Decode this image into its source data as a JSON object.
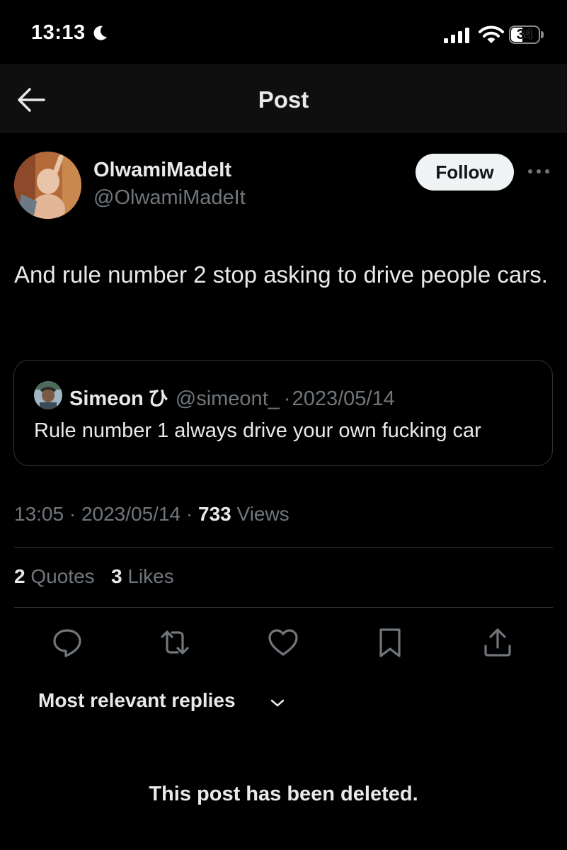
{
  "status_bar": {
    "time": "13:13",
    "battery": "34",
    "icons": [
      "moon-icon",
      "cellular-signal-icon",
      "wifi-icon",
      "battery-icon"
    ]
  },
  "nav": {
    "title": "Post",
    "back_icon": "arrow-left-icon"
  },
  "post": {
    "author": {
      "name": "OlwamiMadeIt",
      "handle": "@OlwamiMadeIt"
    },
    "follow_label": "Follow",
    "more_icon": "ellipsis-icon",
    "text": "And rule number 2 stop asking to drive people cars.",
    "quote": {
      "name": "Simeon",
      "badge": "ひ",
      "handle": "@simeont_",
      "separator": "·",
      "date": "2023/05/14",
      "text": "Rule number 1 always drive your own fucking car"
    },
    "meta": {
      "time": "13:05",
      "date": "2023/05/14",
      "views_count": "733",
      "views_label": "Views"
    },
    "stats": {
      "quotes_count": "2",
      "quotes_label": "Quotes",
      "likes_count": "3",
      "likes_label": "Likes"
    },
    "actions": [
      "reply-icon",
      "repost-icon",
      "like-icon",
      "bookmark-icon",
      "share-icon"
    ]
  },
  "replies": {
    "sort_label": "Most relevant replies",
    "deleted_notice": "This post has been deleted."
  },
  "colors": {
    "background": "#000000",
    "text_primary": "#e7e9ea",
    "text_secondary": "#71767b",
    "border": "#2f3336",
    "follow_bg": "#eff3f4"
  }
}
